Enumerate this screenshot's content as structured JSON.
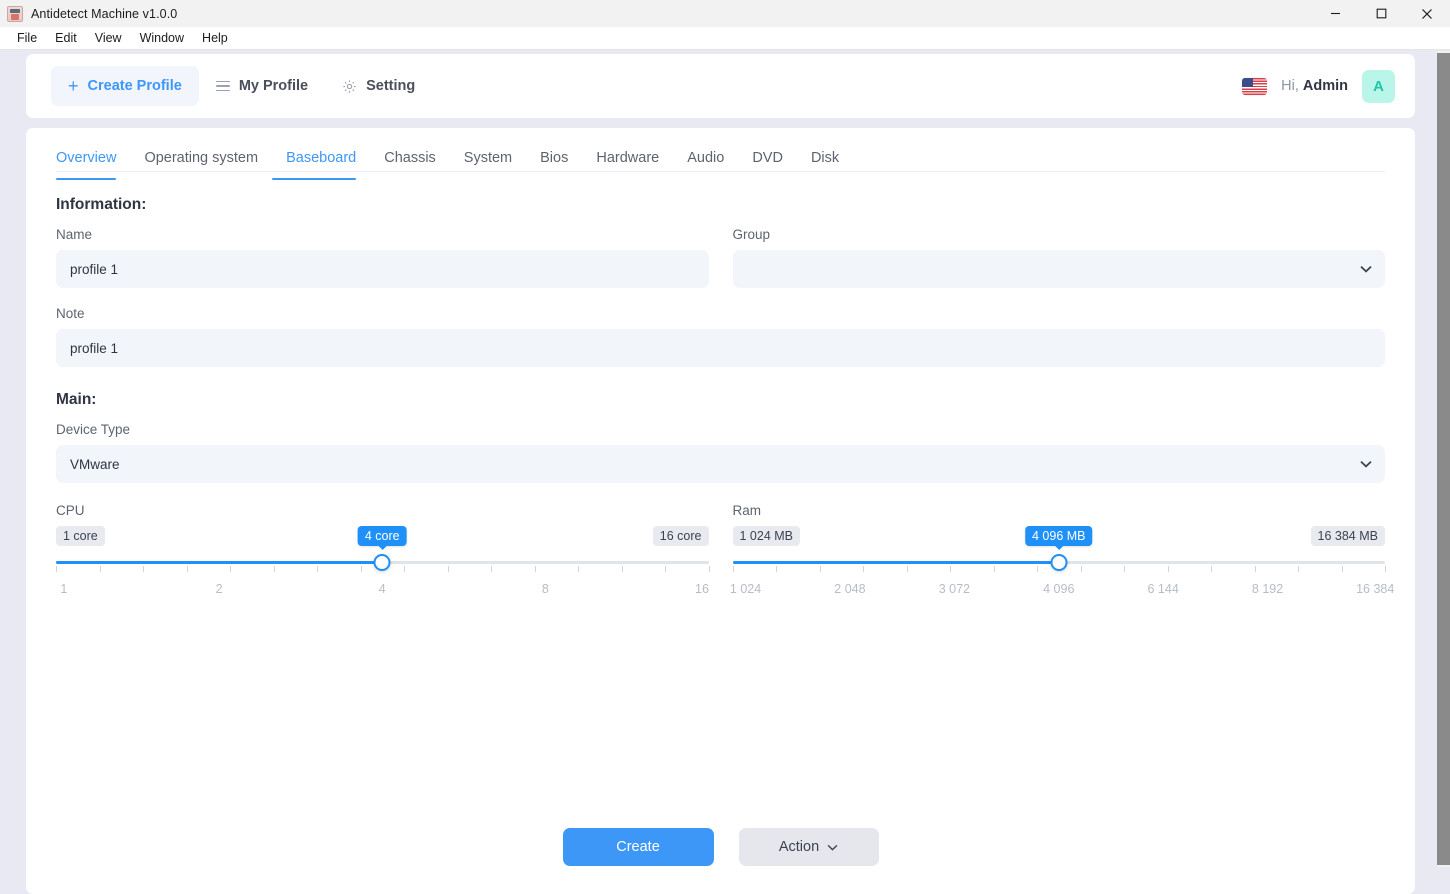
{
  "window": {
    "title": "Antidetect Machine v1.0.0",
    "app_icon": "app-icon",
    "controls": {
      "minimize": "minimize-icon",
      "maximize": "maximize-icon",
      "close": "close-icon"
    }
  },
  "menubar": {
    "items": [
      "File",
      "Edit",
      "View",
      "Window",
      "Help"
    ]
  },
  "toolbar": {
    "create_profile": "Create Profile",
    "my_profile": "My Profile",
    "setting": "Setting",
    "icons": {
      "create": "plus-icon",
      "my_profile": "list-icon",
      "setting": "gear-icon"
    }
  },
  "header_right": {
    "flag": "us-flag-icon",
    "greeting_prefix": "Hi, ",
    "user_name": "Admin",
    "avatar_initial": "A"
  },
  "tabs": [
    {
      "label": "Overview",
      "active": true
    },
    {
      "label": "Operating system",
      "active": false
    },
    {
      "label": "Baseboard",
      "active": true
    },
    {
      "label": "Chassis",
      "active": false
    },
    {
      "label": "System",
      "active": false
    },
    {
      "label": "Bios",
      "active": false
    },
    {
      "label": "Hardware",
      "active": false
    },
    {
      "label": "Audio",
      "active": false
    },
    {
      "label": "DVD",
      "active": false
    },
    {
      "label": "Disk",
      "active": false
    }
  ],
  "information": {
    "title": "Information:",
    "name_label": "Name",
    "name_value": "profile 1",
    "name_placeholder": "",
    "group_label": "Group",
    "group_value": "",
    "note_label": "Note",
    "note_value": "profile 1",
    "note_placeholder": ""
  },
  "main": {
    "title": "Main:",
    "device_type_label": "Device Type",
    "device_type_value": "VMware"
  },
  "cpu_slider": {
    "label": "CPU",
    "min_badge": "1 core",
    "max_badge": "16 core",
    "current_badge": "4 core",
    "min": 1,
    "max": 16,
    "value": 4,
    "scale": [
      "1",
      "2",
      "4",
      "8",
      "16"
    ],
    "accent": "#1e90f7"
  },
  "ram_slider": {
    "label": "Ram",
    "min_badge": "1 024 MB",
    "max_badge": "16 384 MB",
    "current_badge": "4 096 MB",
    "min": 1024,
    "max": 16384,
    "value": 4096,
    "scale": [
      "1 024",
      "2 048",
      "3 072",
      "4 096",
      "6 144",
      "8 192",
      "16 384"
    ],
    "accent": "#1e90f7"
  },
  "footer": {
    "create_label": "Create",
    "action_label": "Action",
    "action_caret": "chevron-down-icon"
  }
}
